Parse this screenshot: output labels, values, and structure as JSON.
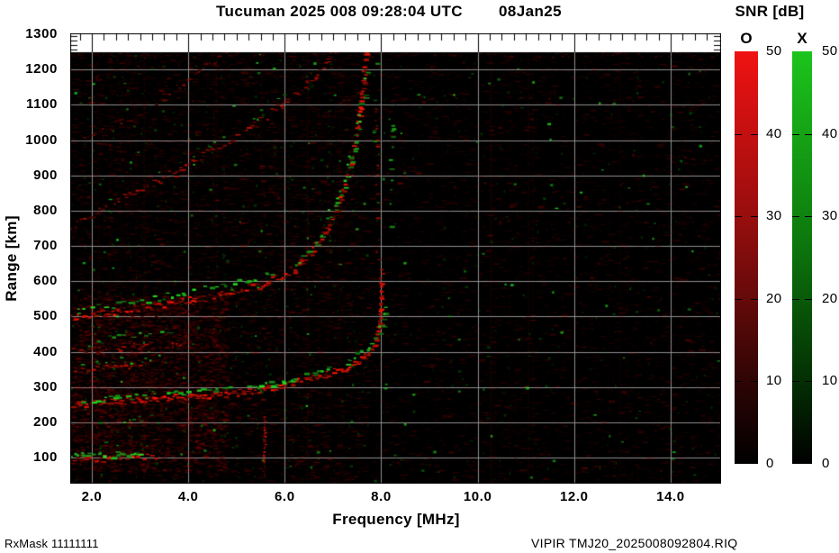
{
  "title": {
    "text": "Tucuman 2025 008 09:28:04 UTC",
    "date": "08Jan25"
  },
  "footer": {
    "left": "RxMask 11111111",
    "right": "VIPIR  TMJ20_2025008092804.RIQ"
  },
  "axes": {
    "x": {
      "title": "Frequency [MHz]",
      "tick_labels": [
        "2.0",
        "4.0",
        "6.0",
        "8.0",
        "10.0",
        "12.0",
        "14.0"
      ],
      "tick_values": [
        2,
        4,
        6,
        8,
        10,
        12,
        14
      ],
      "min": 1.55,
      "max": 15.05,
      "minor_step": 0.25
    },
    "y": {
      "title": "Range [km]",
      "tick_values": [
        1300,
        1200,
        1100,
        1000,
        900,
        800,
        700,
        600,
        500,
        400,
        300,
        200,
        100
      ],
      "min_km": 26,
      "max_km": 1300
    }
  },
  "colorbar": {
    "title": "SNR [dB]",
    "tick_values": [
      50,
      40,
      30,
      20,
      10,
      0
    ],
    "min": 0,
    "max": 50,
    "bars": [
      {
        "label": "O",
        "polarization": "ordinary",
        "color": "#f01212"
      },
      {
        "label": "X",
        "polarization": "extraordinary",
        "color": "#1cc41c"
      }
    ]
  },
  "chart_data": {
    "type": "heatmap",
    "title": "VIPIR ionogram, Tucuman, 2025 day 008 09:28:04 UTC",
    "xlabel": "Frequency [MHz]",
    "ylabel": "Range [km]",
    "xlim": [
      1.55,
      15.05
    ],
    "ylim": [
      26,
      1300
    ],
    "grid": {
      "x_mhz": [
        2,
        4,
        6,
        8,
        10,
        12,
        14
      ],
      "y_km": [
        100,
        200,
        300,
        400,
        500,
        600,
        700,
        800,
        900,
        1000,
        1100,
        1200
      ]
    },
    "snr_scale": {
      "min_db": 0,
      "max_db": 50,
      "o_mode_color": "red",
      "x_mode_color": "green"
    },
    "background_color": "#000000",
    "gridline_color": "#8f8f8f",
    "trace_colors": {
      "O": [
        255,
        22,
        0
      ],
      "X": [
        35,
        225,
        35
      ]
    },
    "features": {
      "sporadic_e_km": 105,
      "f_layer_min_virtual_height_km": 250,
      "o_mode_critical_freq_mhz": 8.0,
      "x_mode_critical_freq_mhz": 8.15,
      "multiple_hops_km": [
        500,
        750,
        1000
      ],
      "interference_line_mhz": 5.56
    },
    "traces": [
      {
        "mode": "O",
        "pts": [
          [
            1.55,
            120
          ],
          [
            2.5,
            124
          ],
          [
            4.5,
            118
          ]
        ],
        "size": 3,
        "jitter": 9,
        "step": 3,
        "density": 0.3,
        "min": 0.1,
        "max": 0.35
      },
      {
        "mode": "O",
        "pts": [
          [
            1.55,
            240
          ],
          [
            2.5,
            249
          ],
          [
            4,
            259
          ],
          [
            5.5,
            273
          ]
        ],
        "size": 4,
        "jitter": 7,
        "step": 3,
        "density": 0.35,
        "min": 0.12,
        "max": 0.38
      },
      {
        "mode": "O",
        "pts": [
          [
            1.55,
            487
          ],
          [
            3,
            502
          ],
          [
            5,
            552
          ]
        ],
        "size": 4,
        "jitter": 8,
        "step": 3,
        "density": 0.28,
        "min": 0.1,
        "max": 0.32
      },
      {
        "mode": "O",
        "pts": [
          [
            1.55,
            732
          ],
          [
            2.5,
            792
          ],
          [
            3.5,
            862
          ]
        ],
        "size": 3,
        "jitter": 11,
        "step": 3,
        "density": 0.25,
        "min": 0.08,
        "max": 0.28
      },
      {
        "mode": "O",
        "pts": [
          [
            1.55,
            1243
          ],
          [
            15.0,
            1243
          ]
        ],
        "size": 3,
        "jitter": 3,
        "step": 3,
        "density": 0.4,
        "min": 0.08,
        "max": 0.25
      },
      {
        "mode": "O",
        "pts": [
          [
            1.55,
            97
          ],
          [
            2.2,
            99
          ],
          [
            2.9,
            101
          ],
          [
            3.3,
            104
          ]
        ],
        "size": 4,
        "jitter": 4,
        "step": 3,
        "density": 0.95,
        "min": 0.4,
        "max": 1
      },
      {
        "mode": "O",
        "pts": [
          [
            1.55,
            192
          ],
          [
            2.4,
            196
          ],
          [
            3.1,
            199
          ]
        ],
        "size": 3,
        "jitter": 3,
        "step": 3,
        "density": 0.5,
        "min": 0.2,
        "max": 0.55
      },
      {
        "mode": "O",
        "pts": [
          [
            1.55,
            251
          ],
          [
            2.3,
            258
          ],
          [
            3.1,
            266
          ],
          [
            4,
            275
          ],
          [
            5,
            286
          ],
          [
            5.6,
            296
          ],
          [
            6.2,
            316
          ],
          [
            6.8,
            336
          ],
          [
            7.2,
            352
          ],
          [
            7.6,
            384
          ],
          [
            7.85,
            428
          ],
          [
            7.95,
            490
          ],
          [
            7.98,
            600
          ],
          [
            7.97,
            632
          ]
        ],
        "size": 4,
        "jitter": 3.5,
        "step": 2.5,
        "density": 0.97,
        "min": 0.5,
        "max": 1
      },
      {
        "mode": "O",
        "pts": [
          [
            1.55,
            352
          ],
          [
            2.3,
            357
          ],
          [
            3.0,
            363
          ]
        ],
        "size": 3.5,
        "jitter": 3,
        "step": 3,
        "density": 0.75,
        "min": 0.3,
        "max": 0.8
      },
      {
        "mode": "O",
        "pts": [
          [
            1.55,
            404
          ],
          [
            2.3,
            410
          ],
          [
            3.2,
            418
          ],
          [
            3.85,
            424
          ]
        ],
        "size": 3.5,
        "jitter": 4,
        "step": 3,
        "density": 0.75,
        "min": 0.3,
        "max": 0.85
      },
      {
        "mode": "O",
        "pts": [
          [
            1.55,
            498
          ],
          [
            2.3,
            512
          ],
          [
            3.1,
            529
          ],
          [
            4,
            547
          ],
          [
            5,
            572
          ],
          [
            5.6,
            597
          ],
          [
            6.2,
            636
          ],
          [
            6.55,
            690
          ],
          [
            6.9,
            762
          ],
          [
            7.15,
            843
          ],
          [
            7.35,
            935
          ],
          [
            7.5,
            1045
          ],
          [
            7.6,
            1160
          ],
          [
            7.66,
            1255
          ]
        ],
        "size": 4,
        "jitter": 4,
        "step": 2.5,
        "density": 0.9,
        "min": 0.4,
        "max": 1
      },
      {
        "mode": "O",
        "pts": [
          [
            1.55,
            758
          ],
          [
            2.2,
            802
          ],
          [
            3,
            863
          ],
          [
            3.75,
            912
          ],
          [
            4.5,
            975
          ],
          [
            5.3,
            1040
          ],
          [
            6,
            1112
          ],
          [
            6.5,
            1172
          ],
          [
            6.85,
            1215
          ],
          [
            7.0,
            1258
          ]
        ],
        "size": 3.5,
        "jitter": 4.5,
        "step": 3,
        "density": 0.8,
        "min": 0.25,
        "max": 0.75
      },
      {
        "mode": "O",
        "pts": [
          [
            1.7,
            1002
          ],
          [
            2.3,
            1032
          ],
          [
            3,
            1082
          ],
          [
            3.5,
            1122
          ],
          [
            4.2,
            1196
          ],
          [
            4.75,
            1248
          ]
        ],
        "size": 3,
        "jitter": 4,
        "step": 3,
        "density": 0.6,
        "min": 0.18,
        "max": 0.55
      },
      {
        "mode": "O",
        "pts": [
          [
            5.56,
            48
          ],
          [
            5.56,
            86
          ]
        ],
        "size": 2,
        "jitter": 1.5,
        "step": 2,
        "density": 0.8,
        "min": 0.2,
        "max": 0.5
      },
      {
        "mode": "O",
        "pts": [
          [
            5.56,
            88
          ],
          [
            5.57,
            214
          ]
        ],
        "size": 2.5,
        "jitter": 1.5,
        "step": 2,
        "density": 0.95,
        "min": 0.5,
        "max": 1
      },
      {
        "mode": "O",
        "pts": [
          [
            7.9,
            640
          ],
          [
            7.88,
            1100
          ]
        ],
        "size": 3,
        "jitter": 2.5,
        "step": 3,
        "density": 0.35,
        "min": 0.2,
        "max": 0.7
      },
      {
        "mode": "X",
        "pts": [
          [
            1.55,
            106
          ],
          [
            2.1,
            107
          ],
          [
            2.6,
            109
          ],
          [
            2.95,
            112
          ]
        ],
        "size": 5,
        "jitter": 3.5,
        "step": 4,
        "density": 0.8,
        "min": 0.5,
        "max": 1
      },
      {
        "mode": "X",
        "pts": [
          [
            1.6,
            128
          ],
          [
            2.3,
            133
          ],
          [
            3.0,
            130
          ]
        ],
        "size": 3,
        "jitter": 6,
        "step": 5,
        "density": 0.25,
        "min": 0.25,
        "max": 0.6
      },
      {
        "mode": "X",
        "pts": [
          [
            1.7,
            205
          ],
          [
            2.5,
            209
          ],
          [
            3.2,
            213
          ],
          [
            3.6,
            216
          ]
        ],
        "size": 3.5,
        "jitter": 4,
        "step": 5,
        "density": 0.3,
        "min": 0.25,
        "max": 0.7
      },
      {
        "mode": "X",
        "pts": [
          [
            1.7,
            262
          ],
          [
            2.5,
            271
          ],
          [
            3.5,
            281
          ],
          [
            4.5,
            293
          ],
          [
            5.5,
            306
          ],
          [
            6.2,
            327
          ],
          [
            6.9,
            353
          ],
          [
            7.3,
            374
          ],
          [
            7.7,
            410
          ],
          [
            7.95,
            458
          ],
          [
            8.07,
            525
          ],
          [
            8.13,
            568
          ]
        ],
        "size": 4.5,
        "jitter": 3,
        "step": 4,
        "density": 0.65,
        "min": 0.45,
        "max": 1
      },
      {
        "mode": "X",
        "pts": [
          [
            1.7,
            368
          ],
          [
            2.4,
            375
          ],
          [
            3.0,
            382
          ],
          [
            3.4,
            386
          ]
        ],
        "size": 3.5,
        "jitter": 4.5,
        "step": 5,
        "density": 0.35,
        "min": 0.3,
        "max": 0.8
      },
      {
        "mode": "X",
        "pts": [
          [
            1.7,
            428
          ],
          [
            2.3,
            436
          ],
          [
            3.0,
            446
          ],
          [
            3.6,
            452
          ]
        ],
        "size": 4,
        "jitter": 5,
        "step": 5,
        "density": 0.4,
        "min": 0.3,
        "max": 0.85
      },
      {
        "mode": "X",
        "pts": [
          [
            1.7,
            516
          ],
          [
            2.5,
            536
          ],
          [
            3.5,
            559
          ],
          [
            4.5,
            583
          ],
          [
            5.5,
            614
          ],
          [
            6.2,
            652
          ],
          [
            6.7,
            728
          ],
          [
            7.0,
            805
          ],
          [
            7.25,
            895
          ],
          [
            7.45,
            1005
          ],
          [
            7.6,
            1125
          ],
          [
            7.7,
            1235
          ]
        ],
        "size": 4.5,
        "jitter": 3.5,
        "step": 4.5,
        "density": 0.55,
        "min": 0.4,
        "max": 1
      },
      {
        "mode": "X",
        "pts": [
          [
            2.0,
            802
          ],
          [
            2.8,
            862
          ],
          [
            3.6,
            922
          ],
          [
            4.4,
            992
          ],
          [
            5.1,
            1046
          ],
          [
            5.8,
            1108
          ],
          [
            6.3,
            1162
          ]
        ],
        "size": 3.5,
        "jitter": 5,
        "step": 6,
        "density": 0.3,
        "min": 0.3,
        "max": 0.75
      },
      {
        "mode": "X",
        "pts": [
          [
            8.2,
            688
          ],
          [
            8.18,
            1152
          ]
        ],
        "size": 4,
        "jitter": 3,
        "step": 5,
        "density": 0.35,
        "min": 0.3,
        "max": 0.85
      },
      {
        "mode": "X",
        "pts": [
          [
            7.85,
            952
          ],
          [
            7.83,
            1232
          ]
        ],
        "size": 3.5,
        "jitter": 3,
        "step": 6,
        "density": 0.3,
        "min": 0.3,
        "max": 0.7
      },
      {
        "mode": "X",
        "pts": [
          [
            2.5,
            1062
          ],
          [
            3.2,
            1112
          ]
        ],
        "size": 3,
        "jitter": 4,
        "step": 8,
        "density": 0.2,
        "min": 0.25,
        "max": 0.6
      }
    ],
    "noise": {
      "seed": 1337,
      "red_dashes": 16000,
      "red_diffuse": 2600,
      "green_specks": 1500,
      "green_bright": 130,
      "stripes": 85,
      "left_fraction": 0.45,
      "left_keep": 0.9,
      "right_keep": 0.45
    }
  }
}
